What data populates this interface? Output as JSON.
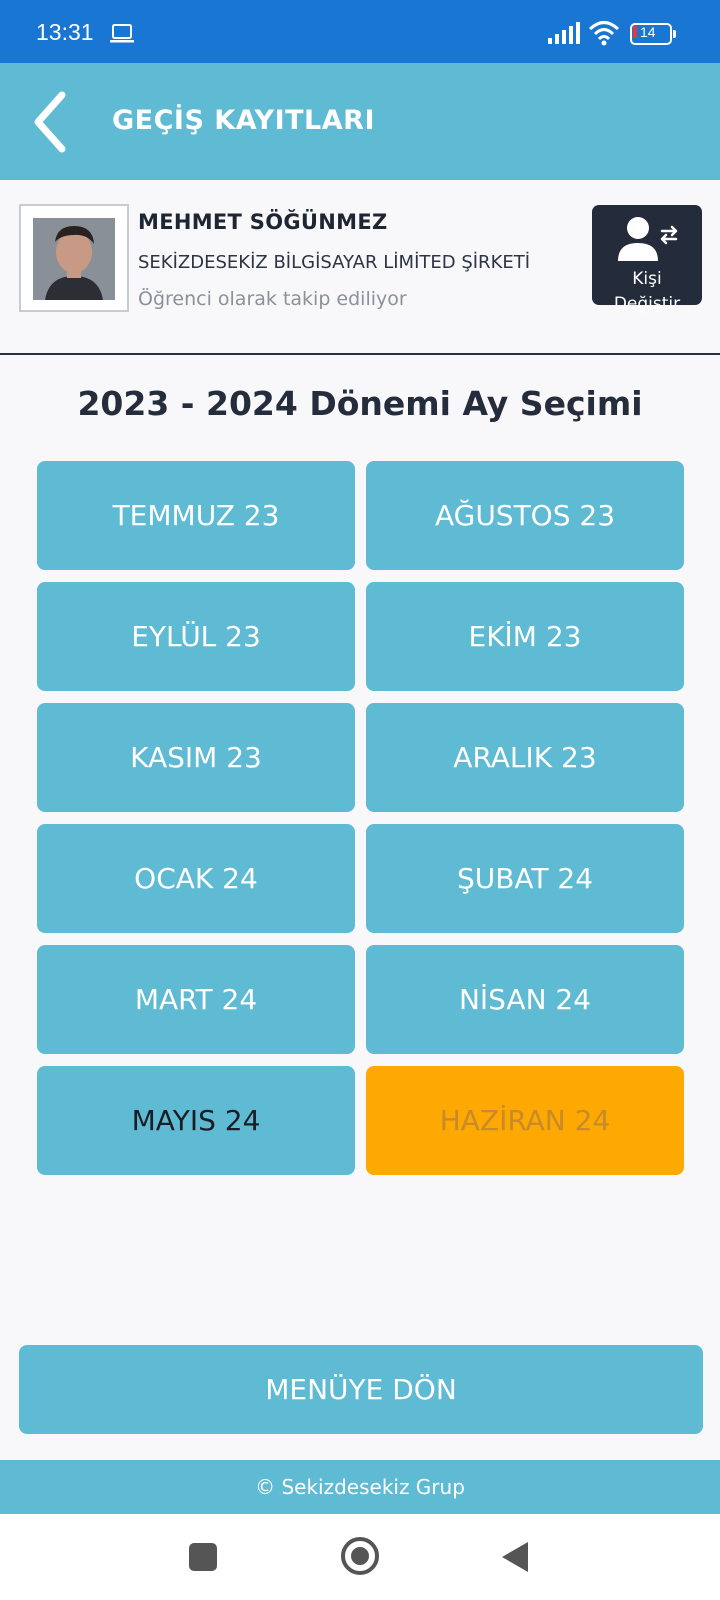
{
  "status_bar": {
    "time": "13:31",
    "battery": "14",
    "icons": [
      "laptop-icon",
      "signal-icon",
      "wifi-icon",
      "battery-icon"
    ]
  },
  "header": {
    "title": "GEÇİŞ KAYITLARI",
    "back_icon": "chevron-left-icon"
  },
  "profile": {
    "name": "MEHMET SÖĞÜNMEZ",
    "company": "SEKİZDESEKİZ BİLGİSAYAR LİMİTED ŞİRKETİ",
    "status": "Öğrenci olarak takip ediliyor",
    "change_button": {
      "line1": "Kişi",
      "line2": "Değiştir",
      "icon": "user-swap-icon"
    }
  },
  "period": {
    "title": "2023 - 2024 Dönemi Ay Seçimi"
  },
  "months": [
    {
      "label": "TEMMUZ 23"
    },
    {
      "label": "AĞUSTOS 23"
    },
    {
      "label": "EYLÜL 23"
    },
    {
      "label": "EKİM 23"
    },
    {
      "label": "KASIM 23"
    },
    {
      "label": "ARALIK 23"
    },
    {
      "label": "OCAK 24"
    },
    {
      "label": "ŞUBAT 24"
    },
    {
      "label": "MART 24"
    },
    {
      "label": "NİSAN 24"
    },
    {
      "label": "MAYIS 24"
    },
    {
      "label": "HAZİRAN 24"
    }
  ],
  "selected_month": "HAZİRAN 24",
  "menu_button": {
    "label": "MENÜYE DÖN"
  },
  "footer": {
    "text": "© Sekizdesekiz Grup"
  },
  "colors": {
    "status_bar": "#1976d2",
    "primary": "#5fbad4",
    "active": "#fea802",
    "dark": "#242b3a"
  }
}
